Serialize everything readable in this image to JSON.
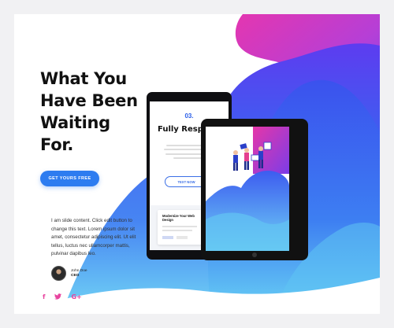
{
  "hero": {
    "title_lines": [
      "What You",
      "Have Been",
      "Waiting",
      "For."
    ],
    "cta_label": "GET YOURS FREE"
  },
  "content": {
    "body": "I am slide content. Click edit button to change this text. Lorem ipsum dolor sit amet, consectetur adipiscing elit. Ut elit tellus, luctus nec ullamcorper mattis, pulvinar dapibus leo."
  },
  "author": {
    "name": "John Doe",
    "role": "CEO"
  },
  "social": {
    "facebook_glyph": "f",
    "twitter_glyph": "•",
    "google_glyph": "G+"
  },
  "phone": {
    "number": "03.",
    "title": "Fully Responsive",
    "button_label": "TEXT NOW",
    "card_title": "Modernize Your Web Design"
  },
  "colors": {
    "accent_blue": "#2d7cf0",
    "gradient_pink": "#e436b0",
    "gradient_purple": "#7a3cf0",
    "gradient_blue": "#3266f0",
    "gradient_cyan": "#51b8f0"
  }
}
